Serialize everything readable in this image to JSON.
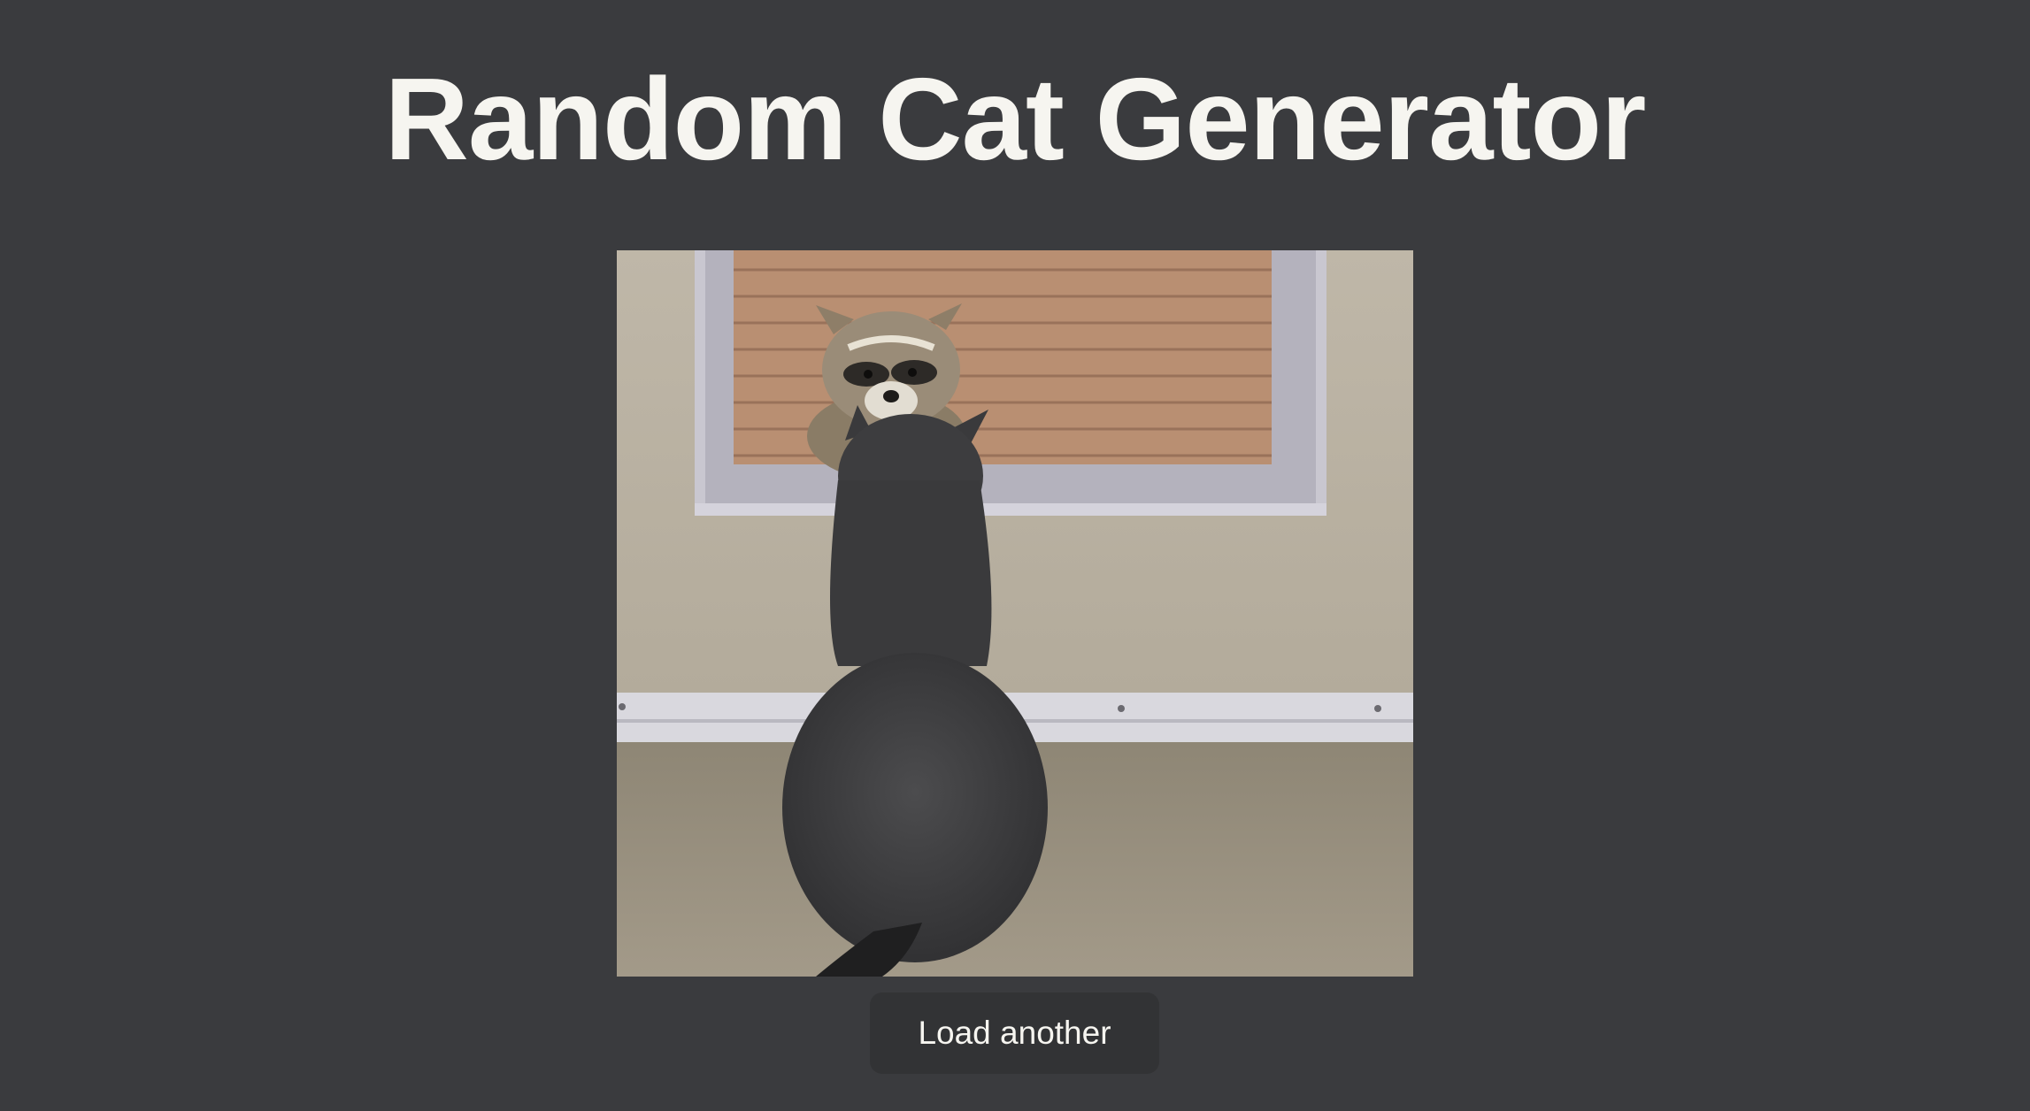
{
  "header": {
    "title": "Random Cat Generator"
  },
  "image": {
    "subject": "gray cat looking at raccoon through window"
  },
  "controls": {
    "load_label": "Load another"
  },
  "colors": {
    "background": "#3a3b3e",
    "text": "#f6f5f0",
    "button_bg": "#323335"
  }
}
